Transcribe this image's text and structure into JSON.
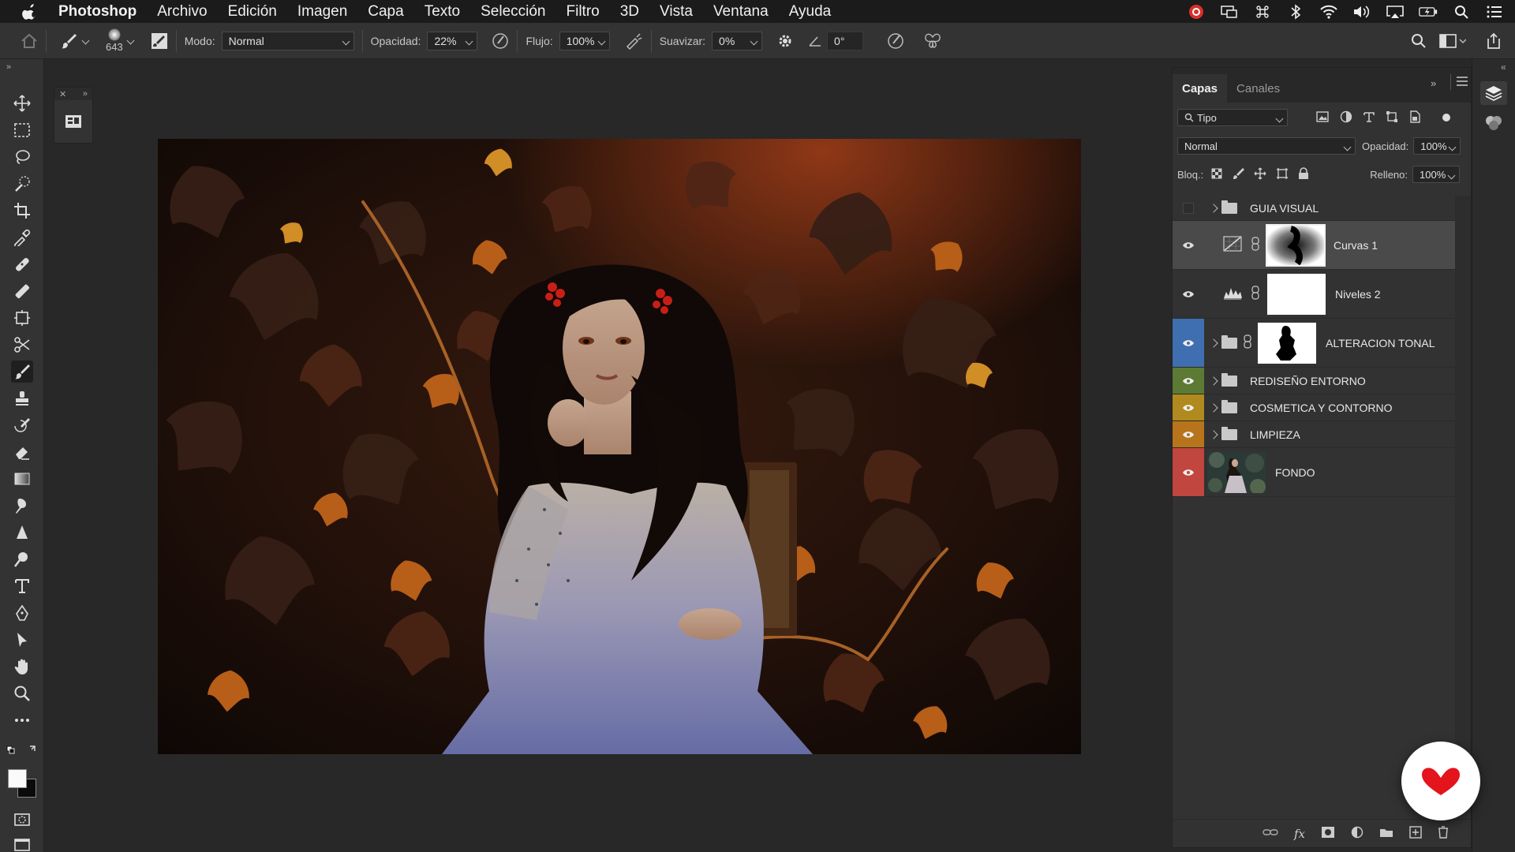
{
  "menubar": {
    "app": "Photoshop",
    "items": [
      "Archivo",
      "Edición",
      "Imagen",
      "Capa",
      "Texto",
      "Selección",
      "Filtro",
      "3D",
      "Vista",
      "Ventana",
      "Ayuda"
    ]
  },
  "options": {
    "brush_size": "643",
    "mode_label": "Modo:",
    "mode_value": "Normal",
    "opacity_label": "Opacidad:",
    "opacity_value": "22%",
    "flow_label": "Flujo:",
    "flow_value": "100%",
    "smooth_label": "Suavizar:",
    "smooth_value": "0%",
    "angle_value": "0°"
  },
  "layers_panel": {
    "tabs": [
      "Capas",
      "Canales"
    ],
    "filter_value": "Tipo",
    "blend_value": "Normal",
    "opacity_label": "Opacidad:",
    "opacity_value": "100%",
    "lock_label": "Bloq.:",
    "fill_label": "Relleno:",
    "fill_value": "100%",
    "layers": [
      {
        "name": "GUIA VISUAL",
        "type": "group",
        "visible": false,
        "color": ""
      },
      {
        "name": "Curvas 1",
        "type": "adjustment-curves",
        "visible": true,
        "selected": true,
        "color": ""
      },
      {
        "name": "Niveles 2",
        "type": "adjustment-levels",
        "visible": true,
        "color": ""
      },
      {
        "name": "ALTERACION TONAL",
        "type": "group-masked",
        "visible": true,
        "color": "#3f6fb0"
      },
      {
        "name": "REDISEÑO ENTORNO",
        "type": "group",
        "visible": true,
        "color": "#5c7a34"
      },
      {
        "name": "COSMETICA Y CONTORNO",
        "type": "group",
        "visible": true,
        "color": "#b08a1f"
      },
      {
        "name": "LIMPIEZA",
        "type": "group",
        "visible": true,
        "color": "#b8741b"
      },
      {
        "name": "FONDO",
        "type": "image",
        "visible": true,
        "color": "#c0463f"
      }
    ]
  },
  "colors": {
    "accent_red": "#e3141b"
  }
}
